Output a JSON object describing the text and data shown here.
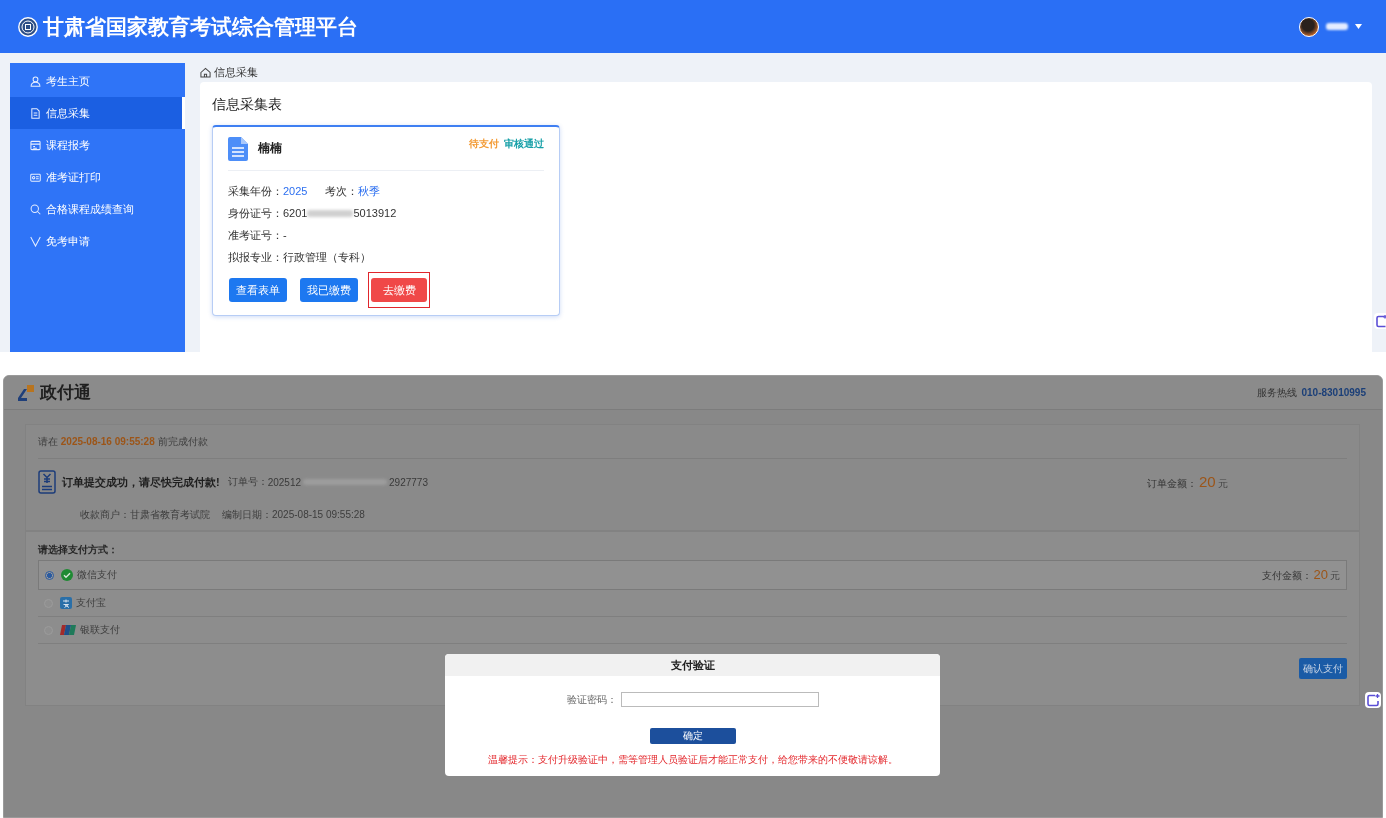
{
  "portal": {
    "header": {
      "title": "甘肃省国家教育考试综合管理平台"
    },
    "sidebar": {
      "items": [
        {
          "label": "考生主页",
          "selected": false
        },
        {
          "label": "信息采集",
          "selected": true
        },
        {
          "label": "课程报考",
          "selected": false
        },
        {
          "label": "准考证打印",
          "selected": false
        },
        {
          "label": "合格课程成绩查询",
          "selected": false
        },
        {
          "label": "免考申请",
          "selected": false
        }
      ]
    },
    "breadcrumb": "信息采集",
    "panel_title": "信息采集表",
    "card": {
      "name": "楠楠",
      "statuses": [
        {
          "label": "待支付",
          "color": "#f39b35"
        },
        {
          "label": "审核通过",
          "color": "#17a0a8"
        }
      ],
      "rows": [
        [
          {
            "label": "采集年份：",
            "value": "2025",
            "kind": "accent"
          },
          {
            "label": "考次：",
            "value": "秋季",
            "kind": "accent"
          }
        ],
        [
          {
            "label": "身份证号：",
            "value": "6201",
            "value_end": "5013912",
            "kind": "redacted"
          }
        ],
        [
          {
            "label": "准考证号：",
            "value": "-",
            "kind": "plain"
          }
        ],
        [
          {
            "label": "拟报专业：",
            "value": "行政管理（专科）",
            "kind": "plain"
          }
        ]
      ],
      "buttons": [
        {
          "label": "查看表单",
          "kind": "primary",
          "highlighted": false
        },
        {
          "label": "我已缴费",
          "kind": "primary",
          "highlighted": false
        },
        {
          "label": "去缴费",
          "kind": "danger",
          "highlighted": true
        }
      ]
    }
  },
  "payment": {
    "header": {
      "logo_text": "政付通",
      "hotline_label": "服务热线",
      "hotline_number": "010-83010995"
    },
    "deadline": "请在 **2025-08-16 09:55:28** 前完成付款",
    "order": {
      "message": "订单提交成功，请尽快完成付款!",
      "number_label": "订单号：",
      "number_start": "202512",
      "number_end": "2927773",
      "amount_label": "订单金额：",
      "amount": "20",
      "amount_unit": "元",
      "merchant": "收款商户：甘肃省教育考试院",
      "date": "编制日期：2025-08-15 09:55:28"
    },
    "methods_title": "请选择支付方式：",
    "methods": [
      {
        "label": "微信支付",
        "selected": true
      },
      {
        "label": "支付宝",
        "selected": false
      },
      {
        "label": "银联支付",
        "selected": false
      }
    ],
    "pay_amount": {
      "label": "支付金额：",
      "amount": "20",
      "unit": "元"
    },
    "confirm_button": "确认支付",
    "dialog": {
      "title": "支付验证",
      "field_label": "验证密码：",
      "button": "确定",
      "notice": "温馨提示：支付升级验证中，需等管理人员验证后才能正常支付，给您带来的不便敬请谅解。"
    }
  }
}
